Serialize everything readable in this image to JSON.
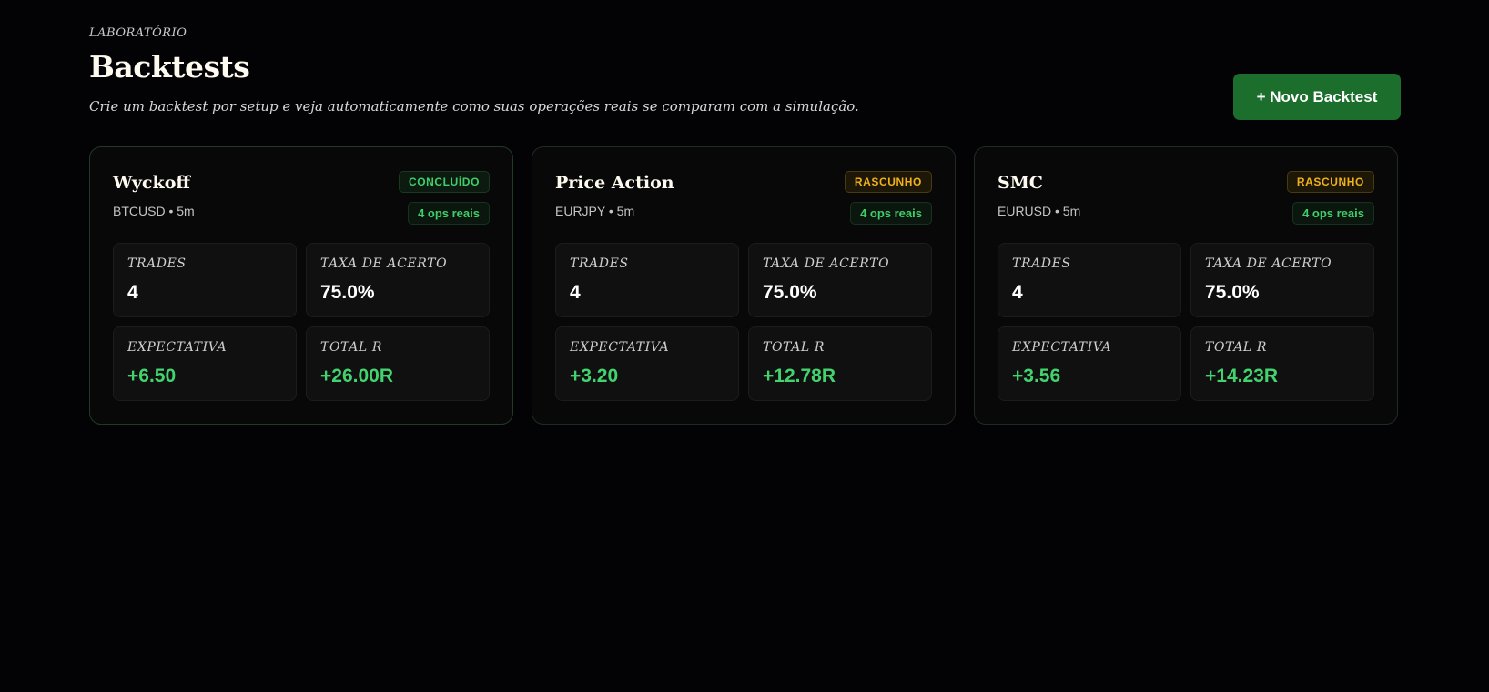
{
  "header": {
    "kicker": "LABORATÓRIO",
    "title": "Backtests",
    "subtitle": "Crie um backtest por setup e veja automaticamente como suas operações reais se comparam com a simulação.",
    "new_button_label": "+ Novo Backtest"
  },
  "colors": {
    "background": "#030305",
    "accent_green": "#1b6e2b",
    "positive": "#43d36e",
    "status_done": "#3ecf6a",
    "status_draft": "#f1b11b"
  },
  "labels": {
    "trades": "TRADES",
    "win_rate": "TAXA DE ACERTO",
    "expectancy": "EXPECTATIVA",
    "total_r": "TOTAL R"
  },
  "cards": [
    {
      "title": "Wyckoff",
      "meta": "BTCUSD • 5m",
      "status": "CONCLUÍDO",
      "ops": "4 ops reais",
      "trades": "4",
      "win_rate": "75.0%",
      "expectancy": "+6.50",
      "total_r": "+26.00R"
    },
    {
      "title": "Price Action",
      "meta": "EURJPY • 5m",
      "status": "RASCUNHO",
      "ops": "4 ops reais",
      "trades": "4",
      "win_rate": "75.0%",
      "expectancy": "+3.20",
      "total_r": "+12.78R"
    },
    {
      "title": "SMC",
      "meta": "EURUSD • 5m",
      "status": "RASCUNHO",
      "ops": "4 ops reais",
      "trades": "4",
      "win_rate": "75.0%",
      "expectancy": "+3.56",
      "total_r": "+14.23R"
    }
  ]
}
